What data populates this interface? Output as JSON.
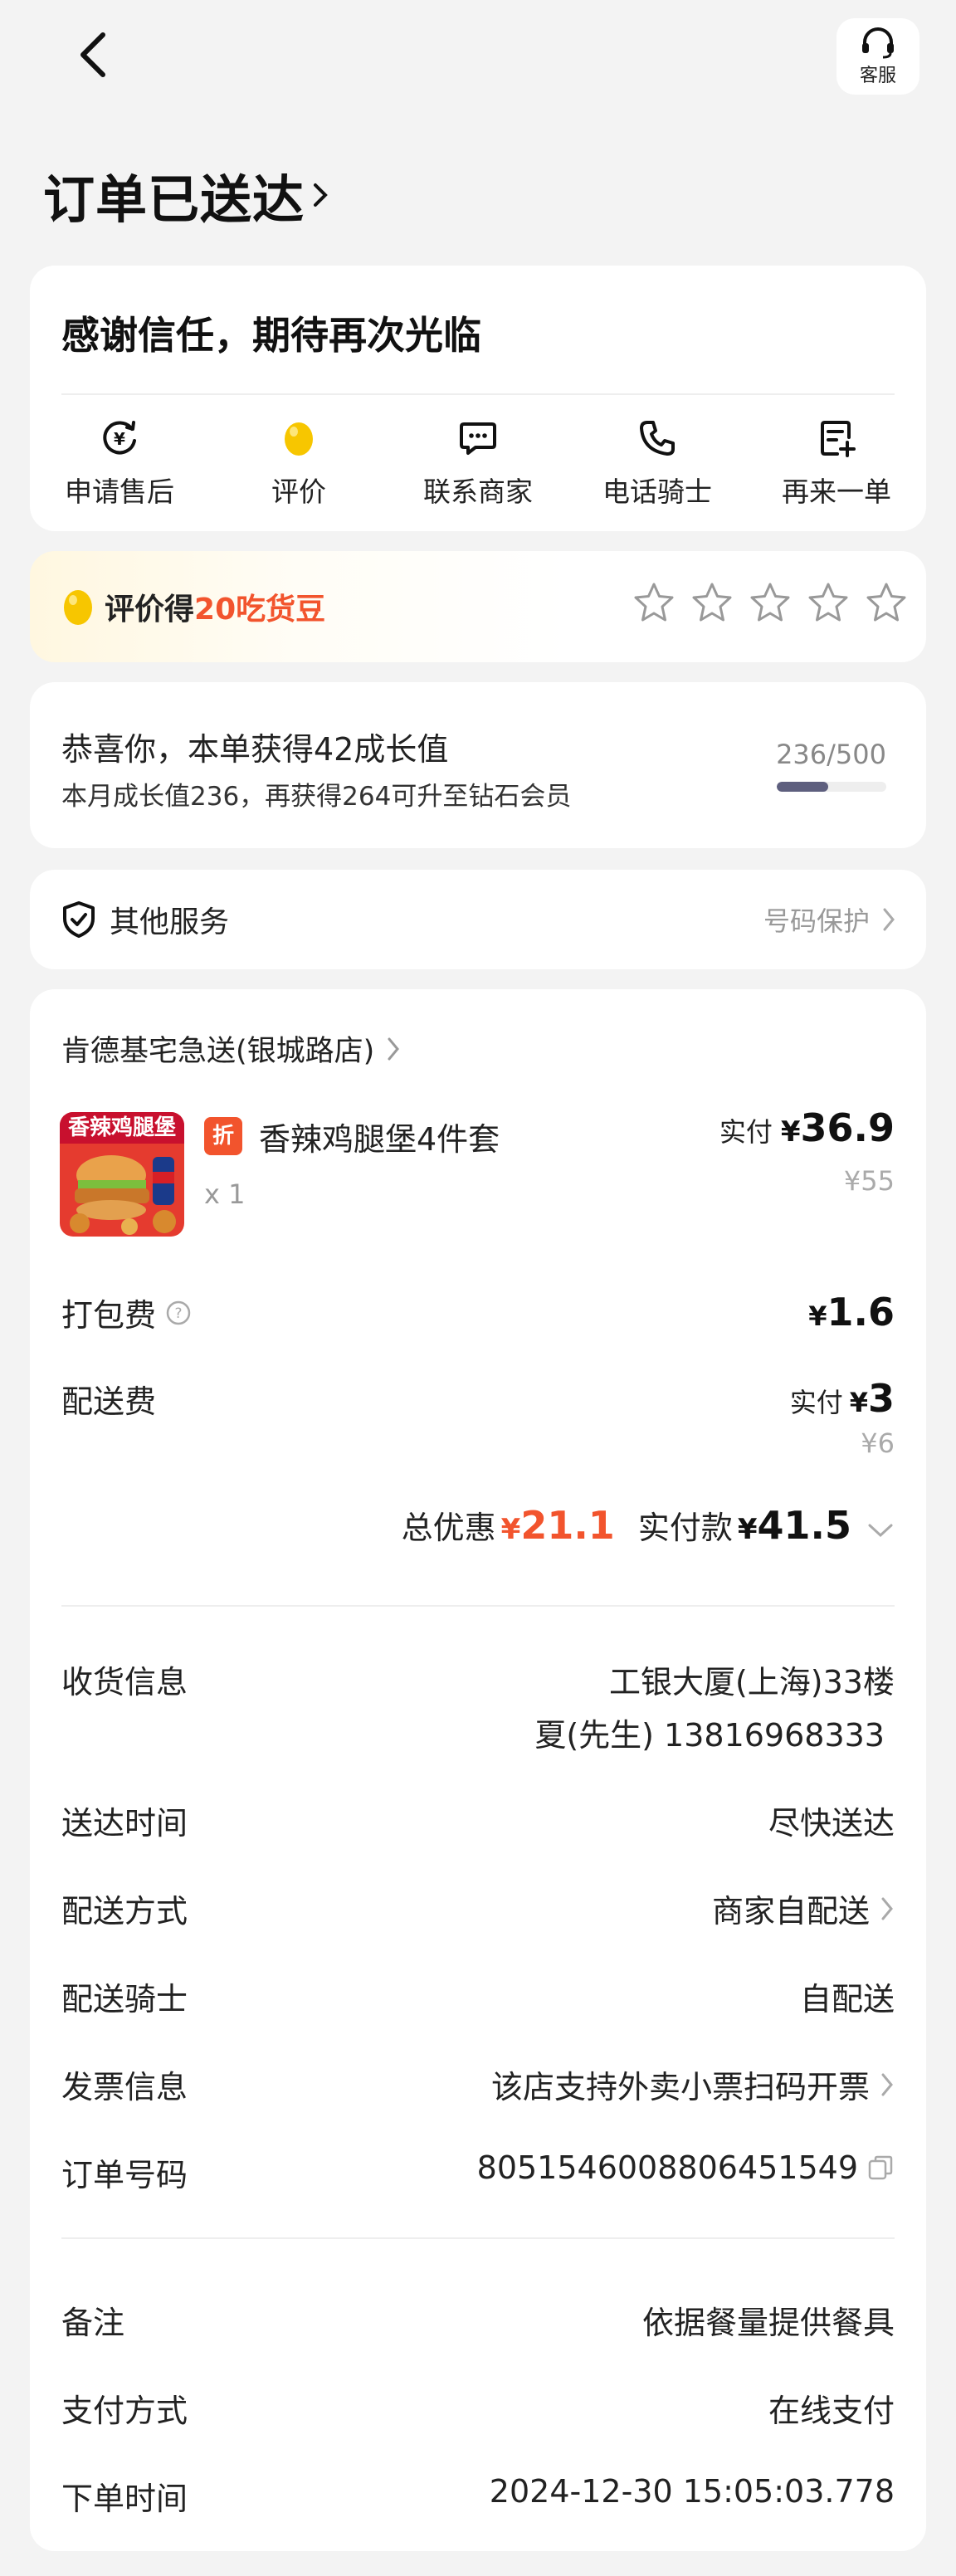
{
  "header": {
    "back_icon": "chevron-left-icon",
    "service_label": "客服",
    "status_title": "订单已送达"
  },
  "thanks": {
    "title": "感谢信任，期待再次光临",
    "actions": [
      {
        "icon": "after-sale-icon",
        "label": "申请售后"
      },
      {
        "icon": "bean-icon",
        "label": "评价"
      },
      {
        "icon": "chat-icon",
        "label": "联系商家"
      },
      {
        "icon": "phone-icon",
        "label": "电话骑士"
      },
      {
        "icon": "reorder-icon",
        "label": "再来一单"
      }
    ]
  },
  "rating": {
    "prefix": "评价得",
    "highlight": "20吃货豆",
    "stars": 0,
    "max_stars": 5
  },
  "growth": {
    "line1": "恭喜你，本单获得42成长值",
    "line2": "本月成长值236，再获得264可升至钻石会员",
    "progress_text": "236/500",
    "progress_fraction": 0.472
  },
  "other_service": {
    "label": "其他服务",
    "right_label": "号码保护"
  },
  "order": {
    "store_name": "肯德基宅急送(银城路店)",
    "item": {
      "image_banner": "香辣鸡腿堡",
      "discount_badge": "折",
      "name": "香辣鸡腿堡4件套",
      "qty": "x 1",
      "paid_label": "实付",
      "currency": "¥",
      "paid": "36.9",
      "original": "¥55"
    },
    "packing_fee": {
      "name": "打包费",
      "currency": "¥",
      "amount": "1.6"
    },
    "delivery_fee": {
      "name": "配送费",
      "paid_label": "实付",
      "currency": "¥",
      "amount": "3",
      "original": "¥6"
    },
    "totals": {
      "discount_label": "总优惠",
      "discount_currency": "¥",
      "discount": "21.1",
      "paid_label": "实付款",
      "paid_currency": "¥",
      "paid": "41.5"
    }
  },
  "details": {
    "address_label": "收货信息",
    "address_line1": "工银大厦(上海)33楼",
    "address_line2": "夏(先生) 13816968333",
    "delivery_time_label": "送达时间",
    "delivery_time": "尽快送达",
    "delivery_method_label": "配送方式",
    "delivery_method": "商家自配送",
    "rider_label": "配送骑士",
    "rider": "自配送",
    "invoice_label": "发票信息",
    "invoice": "该店支持外卖小票扫码开票",
    "order_no_label": "订单号码",
    "order_no": "8051546008806451549",
    "note_label": "备注",
    "note": "依据餐量提供餐具",
    "payment_label": "支付方式",
    "payment": "在线支付",
    "order_time_label": "下单时间",
    "order_time": "2024-12-30 15:05:03.778"
  },
  "colors": {
    "accent_red": "#f2542d",
    "bean_yellow": "#f7c600",
    "background": "#f3f3f3"
  }
}
